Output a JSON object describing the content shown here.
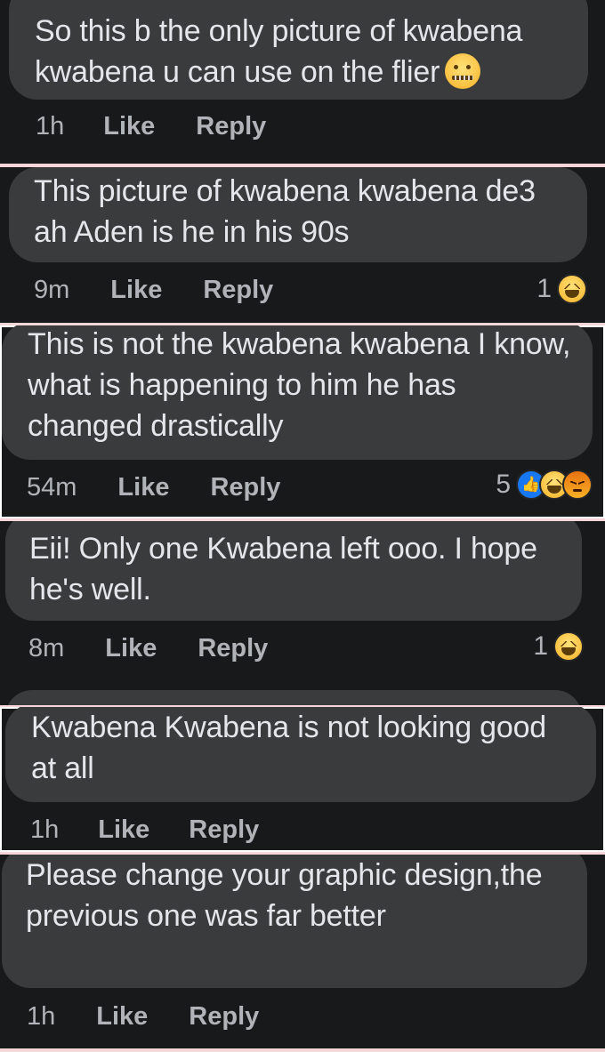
{
  "comments": [
    {
      "text": "So this b the only picture of kwabena kwabena u can use on the flier",
      "emoji": "zipper-mouth-face-icon",
      "time": "1h",
      "like": "Like",
      "reply": "Reply",
      "reaction_count": "",
      "reactions": []
    },
    {
      "text": "This picture of kwabena kwabena de3 ah Aden is he in his 90s",
      "time": "9m",
      "like": "Like",
      "reply": "Reply",
      "reaction_count": "1",
      "reactions": [
        "haha-reaction-icon"
      ]
    },
    {
      "text": "This is not the kwabena kwabena I know, what is happening  to him he has changed  drastically",
      "time": "54m",
      "like": "Like",
      "reply": "Reply",
      "reaction_count": "5",
      "reactions": [
        "like-reaction-icon",
        "haha-reaction-icon",
        "angry-reaction-icon"
      ]
    },
    {
      "text": "Eii! Only one Kwabena left ooo. I hope he's well.",
      "time": "8m",
      "like": "Like",
      "reply": "Reply",
      "reaction_count": "1",
      "reactions": [
        "haha-reaction-icon"
      ]
    },
    {
      "text": "Kwabena Kwabena is not looking good at all",
      "time": "1h",
      "like": "Like",
      "reply": "Reply",
      "reaction_count": "",
      "reactions": []
    },
    {
      "text": "Please change your graphic design,the previous one was far better",
      "time": "1h",
      "like": "Like",
      "reply": "Reply",
      "reaction_count": "",
      "reactions": []
    }
  ],
  "colors": {
    "background": "#18191a",
    "bubble": "#3a3b3c",
    "text": "#e4e6eb",
    "meta": "#b0b3b8",
    "like_blue": "#1877f2",
    "haha_yellow": "#f7b125"
  }
}
